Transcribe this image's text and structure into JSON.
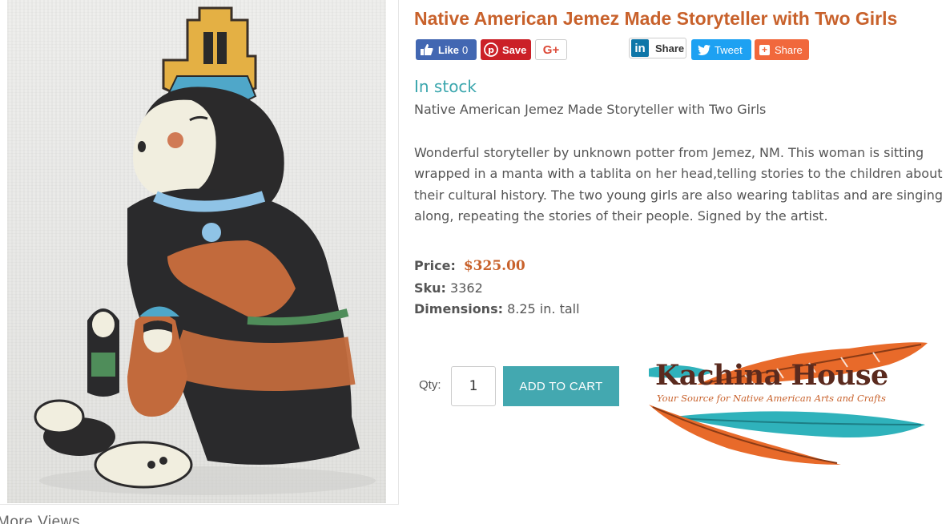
{
  "product": {
    "title": "Native American Jemez Made Storyteller with Two Girls",
    "availability": "In stock",
    "subtitle": "Native American Jemez Made Storyteller with Two Girls",
    "description": "Wonderful storyteller by unknown potter from Jemez, NM. This woman is sitting wrapped in a manta with a tablita on her head,telling stories to the children about their cultural history. The two young girls are also wearing tablitas and are singing along, repeating the stories of their people. Signed by the artist.",
    "price_label": "Price:",
    "price": "$325.00",
    "sku_label": "Sku:",
    "sku": "3362",
    "dimensions_label": "Dimensions:",
    "dimensions": "8.25 in. tall"
  },
  "social": {
    "fb_like": "Like",
    "fb_count": "0",
    "pinterest": "Save",
    "gplus": "G+",
    "linkedin_logo": "in",
    "linkedin": "Share",
    "twitter": "Tweet",
    "share": "Share",
    "share_icon": "+"
  },
  "cart": {
    "qty_label": "Qty:",
    "qty_value": "1",
    "add_label": "ADD TO CART"
  },
  "gallery": {
    "more_views": "More Views"
  },
  "brand": {
    "name": "Kachina House",
    "tagline": "Your Source for Native American Arts and Crafts"
  },
  "colors": {
    "title": "#c8612b",
    "stock": "#3aa6ad",
    "button": "#43a8b0",
    "facebook": "#4267b2",
    "pinterest": "#cb2027",
    "twitter": "#1da1f2",
    "share": "#f1683c"
  },
  "icons": {
    "fb": "thumbs-up-icon",
    "pin": "pinterest-icon",
    "tw": "twitter-bird-icon"
  }
}
